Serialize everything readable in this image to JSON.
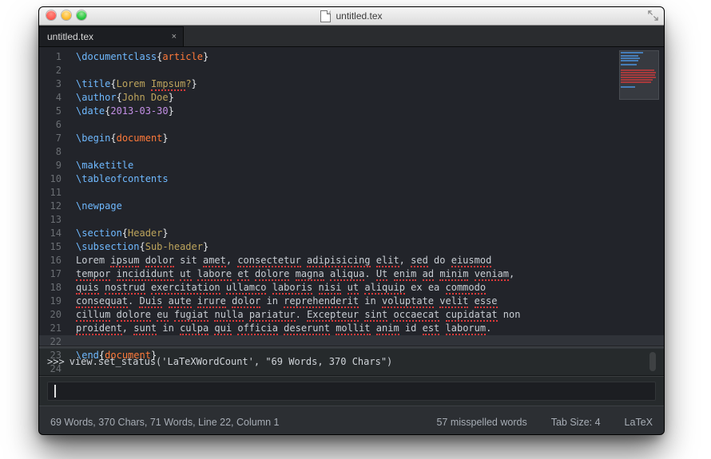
{
  "titlebar": {
    "filename": "untitled.tex"
  },
  "tabs": [
    {
      "label": "untitled.tex",
      "close_glyph": "×"
    }
  ],
  "editor": {
    "current_line_index": 21,
    "lines": [
      {
        "n": "1",
        "k": "latex",
        "cmd": "\\documentclass",
        "arg": "article"
      },
      {
        "n": "2",
        "k": "blank"
      },
      {
        "n": "3",
        "k": "latex",
        "cmd": "\\title",
        "arg": "Lorem Impsum?"
      },
      {
        "n": "4",
        "k": "latex",
        "cmd": "\\author",
        "arg": "John Doe"
      },
      {
        "n": "5",
        "k": "latex",
        "cmd": "\\date",
        "arg": "2013-03-30"
      },
      {
        "n": "6",
        "k": "blank"
      },
      {
        "n": "7",
        "k": "latex",
        "cmd": "\\begin",
        "arg": "document"
      },
      {
        "n": "8",
        "k": "blank"
      },
      {
        "n": "9",
        "k": "cmdonly",
        "cmd": "\\maketitle"
      },
      {
        "n": "10",
        "k": "cmdonly",
        "cmd": "\\tableofcontents"
      },
      {
        "n": "11",
        "k": "blank"
      },
      {
        "n": "12",
        "k": "cmdonly",
        "cmd": "\\newpage"
      },
      {
        "n": "13",
        "k": "blank"
      },
      {
        "n": "14",
        "k": "latex",
        "cmd": "\\section",
        "arg": "Header"
      },
      {
        "n": "15",
        "k": "latex",
        "cmd": "\\subsection",
        "arg": "Sub-header"
      },
      {
        "n": "16",
        "k": "body",
        "txt": "Lorem ipsum dolor sit amet, consectetur adipisicing elit, sed do eiusmod"
      },
      {
        "n": "17",
        "k": "body",
        "txt": "tempor incididunt ut labore et dolore magna aliqua. Ut enim ad minim veniam,"
      },
      {
        "n": "18",
        "k": "body",
        "txt": "quis nostrud exercitation ullamco laboris nisi ut aliquip ex ea commodo"
      },
      {
        "n": "19",
        "k": "body",
        "txt": "consequat. Duis aute irure dolor in reprehenderit in voluptate velit esse"
      },
      {
        "n": "20",
        "k": "body",
        "txt": "cillum dolore eu fugiat nulla pariatur. Excepteur sint occaecat cupidatat non"
      },
      {
        "n": "21",
        "k": "body",
        "txt": "proident, sunt in culpa qui officia deserunt mollit anim id est laborum."
      },
      {
        "n": "22",
        "k": "blank"
      },
      {
        "n": "23",
        "k": "latex",
        "cmd": "\\end",
        "arg": "document"
      },
      {
        "n": "24",
        "k": "blank"
      }
    ]
  },
  "console": {
    "prompt": ">>>",
    "text": "view.set_status('LaTeXWordCount', \"69 Words, 370 Chars\")"
  },
  "inputbar": {
    "value": ""
  },
  "status": {
    "left": "69 Words, 370 Chars, 71 Words, Line 22, Column 1",
    "spell": "57 misspelled words",
    "tab": "Tab Size: 4",
    "lang": "LaTeX"
  },
  "colors": {
    "cmd": "#6fb9ff",
    "keyword": "#ff7a3a",
    "string": "#bda45c",
    "number": "#c38fe5",
    "text": "#c8cdd3"
  }
}
